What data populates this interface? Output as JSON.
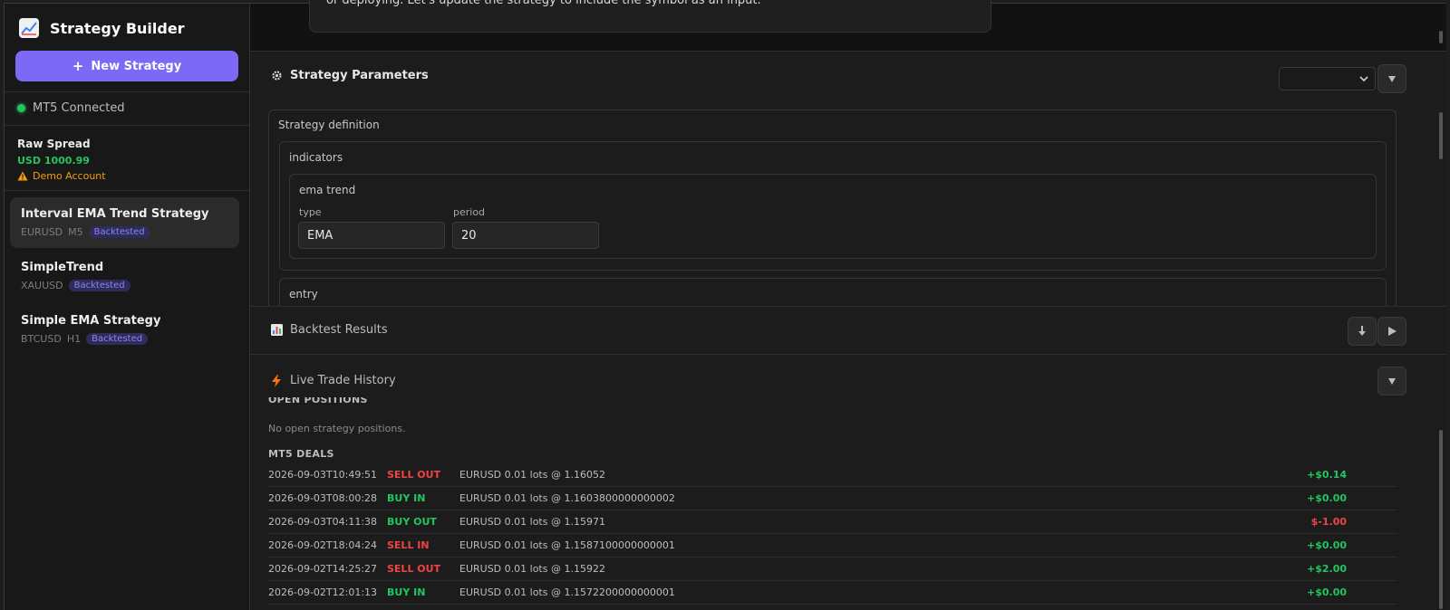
{
  "sidebar": {
    "title": "Strategy Builder",
    "new_strategy_label": "New Strategy",
    "connection_status": "MT5 Connected",
    "account": {
      "name": "Raw Spread",
      "balance": "USD 1000.99",
      "type": "Demo Account"
    },
    "strategies": [
      {
        "name": "Interval EMA Trend Strategy",
        "symbol": "EURUSD",
        "timeframe": "M5",
        "status": "Backtested"
      },
      {
        "name": "SimpleTrend",
        "symbol": "XAUUSD",
        "timeframe": "",
        "status": "Backtested"
      },
      {
        "name": "Simple EMA Strategy",
        "symbol": "BTCUSD",
        "timeframe": "H1",
        "status": "Backtested"
      }
    ]
  },
  "chat": {
    "message_fragment": "or deploying. Let's update the strategy to include the symbol as an input."
  },
  "params": {
    "title": "Strategy Parameters",
    "definition_label": "Strategy definition",
    "indicators_label": "indicators",
    "indicator_name": "ema trend",
    "type_label": "type",
    "type_value": "EMA",
    "period_label": "period",
    "period_value": "20",
    "entry_label": "entry"
  },
  "backtest": {
    "title": "Backtest Results"
  },
  "live": {
    "title": "Live Trade History",
    "open_positions_label": "OPEN POSITIONS",
    "no_positions_text": "No open strategy positions.",
    "deals_label": "MT5 DEALS",
    "deals": [
      {
        "time": "2026-09-03T10:49:51",
        "side": "SELL OUT",
        "desc": "EURUSD 0.01 lots @ 1.16052",
        "pnl": "+$0.14"
      },
      {
        "time": "2026-09-03T08:00:28",
        "side": "BUY IN",
        "desc": "EURUSD 0.01 lots @ 1.1603800000000002",
        "pnl": "+$0.00"
      },
      {
        "time": "2026-09-03T04:11:38",
        "side": "BUY OUT",
        "desc": "EURUSD 0.01 lots @ 1.15971",
        "pnl": "$-1.00"
      },
      {
        "time": "2026-09-02T18:04:24",
        "side": "SELL IN",
        "desc": "EURUSD 0.01 lots @ 1.1587100000000001",
        "pnl": "+$0.00"
      },
      {
        "time": "2026-09-02T14:25:27",
        "side": "SELL OUT",
        "desc": "EURUSD 0.01 lots @ 1.15922",
        "pnl": "+$2.00"
      },
      {
        "time": "2026-09-02T12:01:13",
        "side": "BUY IN",
        "desc": "EURUSD 0.01 lots @ 1.1572200000000001",
        "pnl": "+$0.00"
      }
    ]
  },
  "colors": {
    "accent": "#7c6af6",
    "positive": "#22c55e",
    "negative": "#ef4444",
    "warning": "#f59e0b"
  },
  "icons": [
    "chart-logo-icon",
    "plus-icon",
    "status-dot-icon",
    "warning-icon",
    "gear-icon",
    "bar-chart-icon",
    "lightning-icon",
    "chevron-down-icon",
    "download-icon",
    "play-icon"
  ]
}
